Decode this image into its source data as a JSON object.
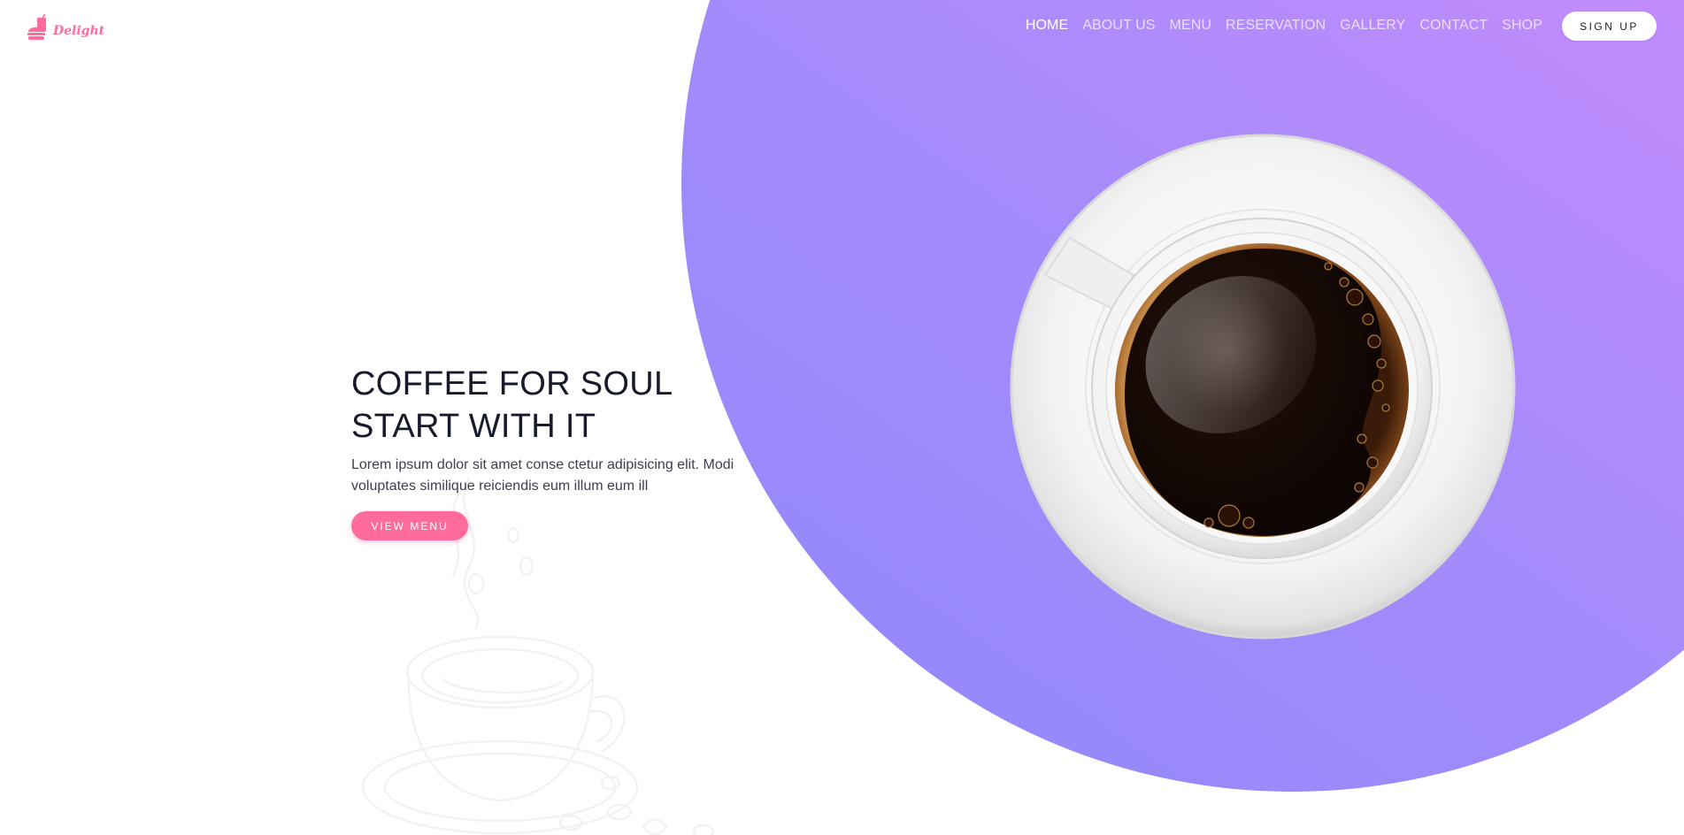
{
  "brand": {
    "name": "Delight",
    "logo_icon": "burger-drink-icon",
    "accent_color": "#ff6b9a"
  },
  "nav": {
    "items": [
      {
        "label": "HOME",
        "active": true
      },
      {
        "label": "ABOUT US",
        "active": false
      },
      {
        "label": "MENU",
        "active": false
      },
      {
        "label": "RESERVATION",
        "active": false
      },
      {
        "label": "GALLERY",
        "active": false
      },
      {
        "label": "CONTACT",
        "active": false
      },
      {
        "label": "SHOP",
        "active": false
      }
    ],
    "signup_label": "SIGN UP"
  },
  "hero": {
    "title_line1": "COFFEE FOR SOUL",
    "title_line2": "START WITH IT",
    "description": "Lorem ipsum dolor sit amet conse ctetur adipisicing elit. Modi voluptates similique reiciendis eum illum eum ill",
    "cta_label": "VIEW MENU",
    "gradient_start": "#8f88fb",
    "gradient_end": "#d98dfe"
  },
  "images": {
    "hero_image": "coffee-cup-top-view",
    "background_sketch": "sketched-coffee-cup"
  }
}
